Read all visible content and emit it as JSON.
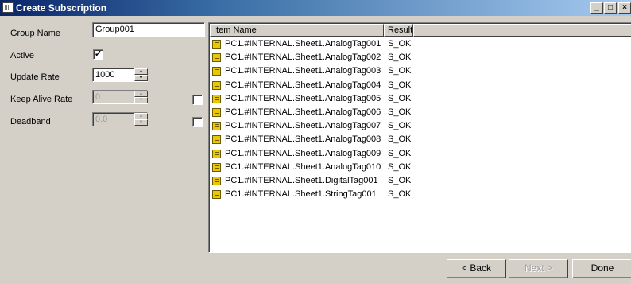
{
  "window": {
    "title": "Create Subscription",
    "icon": "opc-app-icon",
    "controls": {
      "minimize": "_",
      "maximize": "□",
      "close": "×"
    }
  },
  "form": {
    "group_name_label": "Group Name",
    "group_name_value": "Group001",
    "active_label": "Active",
    "active_checked": true,
    "active_mark": "✓",
    "update_rate_label": "Update Rate",
    "update_rate_value": "1000",
    "keep_alive_label": "Keep Alive Rate",
    "keep_alive_value": "0",
    "keep_alive_enabled": false,
    "deadband_label": "Deadband",
    "deadband_value": "0.0",
    "deadband_enabled": false,
    "spin_up": "▲",
    "spin_down": "▼"
  },
  "list": {
    "columns": [
      "Item Name",
      "Result"
    ],
    "rows": [
      {
        "name": "PC1.#INTERNAL.Sheet1.AnalogTag001",
        "result": "S_OK"
      },
      {
        "name": "PC1.#INTERNAL.Sheet1.AnalogTag002",
        "result": "S_OK"
      },
      {
        "name": "PC1.#INTERNAL.Sheet1.AnalogTag003",
        "result": "S_OK"
      },
      {
        "name": "PC1.#INTERNAL.Sheet1.AnalogTag004",
        "result": "S_OK"
      },
      {
        "name": "PC1.#INTERNAL.Sheet1.AnalogTag005",
        "result": "S_OK"
      },
      {
        "name": "PC1.#INTERNAL.Sheet1.AnalogTag006",
        "result": "S_OK"
      },
      {
        "name": "PC1.#INTERNAL.Sheet1.AnalogTag007",
        "result": "S_OK"
      },
      {
        "name": "PC1.#INTERNAL.Sheet1.AnalogTag008",
        "result": "S_OK"
      },
      {
        "name": "PC1.#INTERNAL.Sheet1.AnalogTag009",
        "result": "S_OK"
      },
      {
        "name": "PC1.#INTERNAL.Sheet1.AnalogTag010",
        "result": "S_OK"
      },
      {
        "name": "PC1.#INTERNAL.Sheet1.DigitalTag001",
        "result": "S_OK"
      },
      {
        "name": "PC1.#INTERNAL.Sheet1.StringTag001",
        "result": "S_OK"
      }
    ]
  },
  "buttons": {
    "back": "< Back",
    "next": "Next >",
    "done": "Done",
    "next_enabled": false
  }
}
